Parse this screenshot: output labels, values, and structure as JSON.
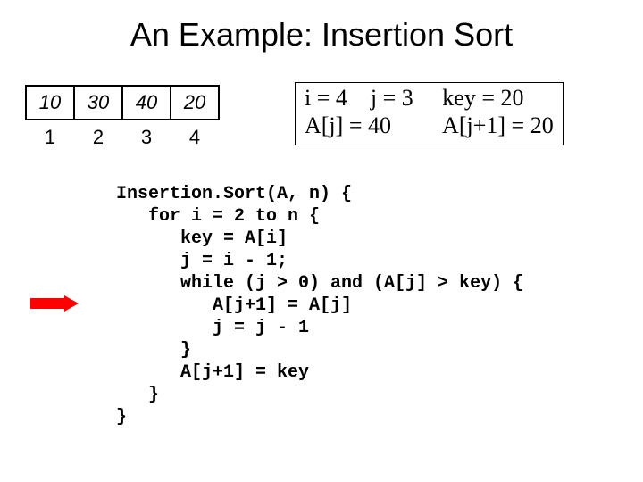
{
  "title": "An Example: Insertion Sort",
  "array": {
    "values": [
      "10",
      "30",
      "40",
      "20"
    ],
    "indices": [
      "1",
      "2",
      "3",
      "4"
    ]
  },
  "state": {
    "line1": "i = 4    j = 3     key = 20",
    "line2": "A[j] = 40         A[j+1] = 20"
  },
  "code": {
    "l1": "Insertion.Sort(A, n) {",
    "l2": "   for i = 2 to n {",
    "l3": "      key = A[i]",
    "l4": "      j = i - 1;",
    "l5": "      while (j > 0) and (A[j] > key) {",
    "l6": "         A[j+1] = A[j]",
    "l7": "         j = j - 1",
    "l8": "      }",
    "l9": "      A[j+1] = key",
    "l10": "   }",
    "l11": "}"
  }
}
